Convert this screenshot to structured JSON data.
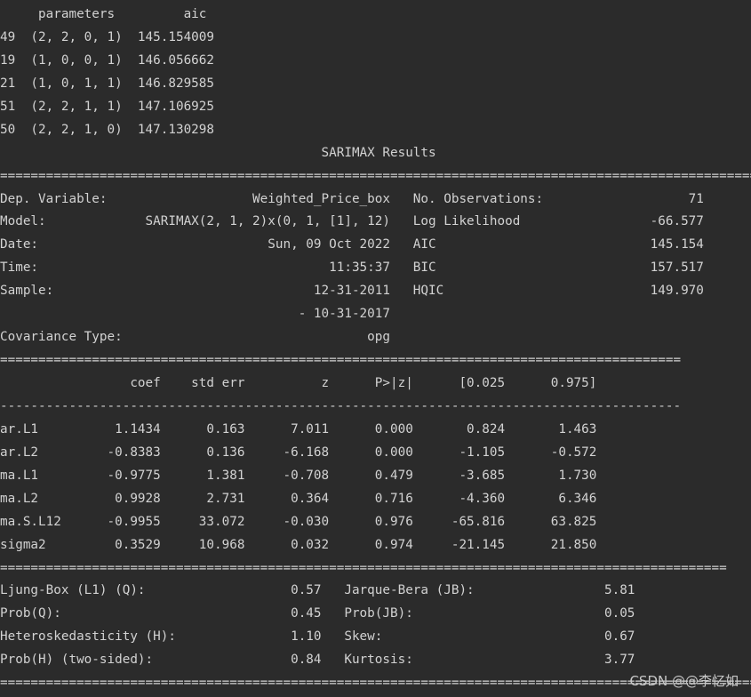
{
  "console": {
    "lines": [
      "     parameters         aic",
      "49  (2, 2, 0, 1)  145.154009",
      "19  (1, 0, 0, 1)  146.056662",
      "21  (1, 0, 1, 1)  146.829585",
      "51  (2, 2, 1, 1)  147.106925",
      "50  (2, 2, 1, 0)  147.130298",
      "                                          SARIMAX Results",
      "=========================================================================================================",
      "Dep. Variable:                   Weighted_Price_box   No. Observations:                   71",
      "Model:             SARIMAX(2, 1, 2)x(0, 1, [1], 12)   Log Likelihood                 -66.577",
      "Date:                              Sun, 09 Oct 2022   AIC                            145.154",
      "Time:                                      11:35:37   BIC                            157.517",
      "Sample:                                  12-31-2011   HQIC                           149.970",
      "                                       - 10-31-2017",
      "Covariance Type:                                opg",
      "=========================================================================================",
      "                 coef    std err          z      P>|z|      [0.025      0.975]",
      "-----------------------------------------------------------------------------------------",
      "ar.L1          1.1434      0.163      7.011      0.000       0.824       1.463",
      "ar.L2         -0.8383      0.136     -6.168      0.000      -1.105      -0.572",
      "ma.L1         -0.9775      1.381     -0.708      0.479      -3.685       1.730",
      "ma.L2          0.9928      2.731      0.364      0.716      -4.360       6.346",
      "ma.S.L12      -0.9955     33.072     -0.030      0.976     -65.816      63.825",
      "sigma2         0.3529     10.968      0.032      0.974     -21.145      21.850",
      "===============================================================================================",
      "Ljung-Box (L1) (Q):                   0.57   Jarque-Bera (JB):                 5.81",
      "Prob(Q):                              0.45   Prob(JB):                         0.05",
      "Heteroskedasticity (H):               1.10   Skew:                             0.67",
      "Prob(H) (two-sided):                  0.84   Kurtosis:                         3.77",
      "========================================================================================================="
    ]
  },
  "watermark": "CSDN @@李忆如",
  "colors": {
    "background": "#2b2b2b",
    "text": "#d2d2d2"
  }
}
